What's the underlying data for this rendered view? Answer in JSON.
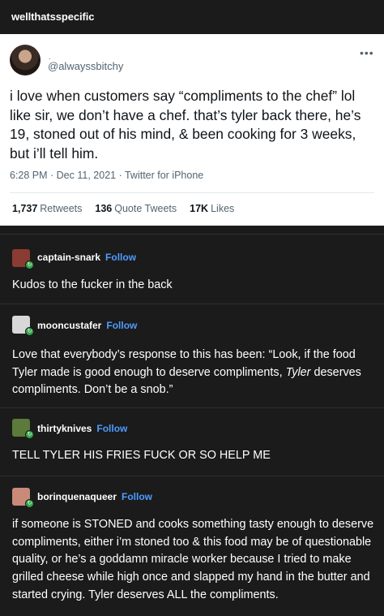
{
  "blog_name": "wellthatsspecific",
  "tweet": {
    "dot": ".",
    "handle": "@alwayssbitchy",
    "more_icon": "more-dots-icon",
    "text": "i love when customers say “compliments to the chef” lol like sir, we don’t have a chef. that’s tyler back there, he’s 19, stoned out of his mind, & been cooking for 3 weeks, but i’ll tell him.",
    "meta": "6:28 PM · Dec 11, 2021 · Twitter for iPhone",
    "retweets_count": "1,737",
    "retweets_label": "Retweets",
    "quotes_count": "136",
    "quotes_label": "Quote Tweets",
    "likes_count": "17K",
    "likes_label": "Likes"
  },
  "follow_label": "Follow",
  "replies": [
    {
      "username": "captain-snark",
      "text": "Kudos to the fucker in the back",
      "avatar_color": "#8a3b32"
    },
    {
      "username": "mooncustafer",
      "text": "Love that everybody’s response to this has been: “Look, if the food Tyler made is good enough to deserve compliments, ",
      "text_italic": "Tyler",
      "text_after": " deserves compliments. Don’t be a snob.”",
      "avatar_color": "#d8d8d8"
    },
    {
      "username": "thirtyknives",
      "text": "TELL TYLER HIS FRIES FUCK OR SO HELP ME",
      "avatar_color": "#5c7a3a"
    },
    {
      "username": "borinquenaqueer",
      "text": "if someone is STONED and cooks something tasty enough to deserve compliments, either i’m stoned too & this food may be of questionable quality, or he’s a goddamn miracle worker because I tried to make grilled cheese while high once and slapped my hand in the butter and started crying. Tyler deserves ALL the compliments.",
      "avatar_color": "#c98a7a"
    }
  ]
}
